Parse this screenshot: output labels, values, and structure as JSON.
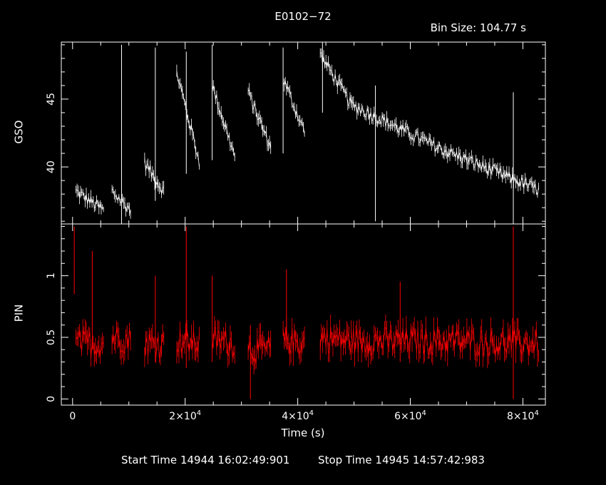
{
  "header": {
    "title": "E0102−72",
    "bin_size": "Bin Size: 104.77 s"
  },
  "footer": {
    "start_label": "Start Time",
    "start_value": "14944 16:02:49:901",
    "stop_label": "Stop Time",
    "stop_value": "14945 14:57:42:983"
  },
  "colors": {
    "gso": "#ffffff",
    "pin": "#ff0000",
    "background": "#000000",
    "axes": "#ffffff"
  },
  "chart_data": [
    {
      "type": "line",
      "panel": "top",
      "ylabel": "GSO",
      "xlim": [
        -2000,
        84000
      ],
      "ylim": [
        35.8,
        49.2
      ],
      "yticks": [
        40,
        45
      ],
      "series": [
        {
          "name": "GSO",
          "segments": [
            {
              "x": [
                600,
                5500
              ],
              "y": [
                38.2,
                36.8
              ]
            },
            {
              "x": [
                7000,
                10300
              ],
              "y": [
                38.2,
                36.8
              ]
            },
            {
              "x": [
                12800,
                16200
              ],
              "y": [
                40.3,
                38.2
              ]
            },
            {
              "x": [
                18500,
                22500
              ],
              "y": [
                47.0,
                40.4
              ]
            },
            {
              "x": [
                24800,
                28800
              ],
              "y": [
                46.0,
                40.8
              ]
            },
            {
              "x": [
                31200,
                35200
              ],
              "y": [
                45.5,
                41.4
              ]
            },
            {
              "x": [
                37400,
                41200
              ],
              "y": [
                46.5,
                42.6
              ]
            },
            {
              "x": [
                44000,
                49500
              ],
              "y": [
                48.3,
                44.6
              ]
            },
            {
              "x": [
                49500,
                65000
              ],
              "y": [
                44.6,
                41.4
              ]
            },
            {
              "x": [
                65000,
                82800
              ],
              "y": [
                41.4,
                38.3
              ]
            }
          ],
          "spikes": [
            {
              "x": 8700,
              "top": 49.0,
              "bottom": 35.8
            },
            {
              "x": 14700,
              "top": 48.8,
              "bottom": 37.5
            },
            {
              "x": 20200,
              "top": 48.5,
              "bottom": 39.5
            },
            {
              "x": 24800,
              "top": 49.0,
              "bottom": 40.5
            },
            {
              "x": 37400,
              "top": 48.8,
              "bottom": 41.0
            },
            {
              "x": 44400,
              "top": 49.2,
              "bottom": 44.0
            },
            {
              "x": 53800,
              "top": 46.0,
              "bottom": 36.0
            },
            {
              "x": 78300,
              "top": 45.5,
              "bottom": 35.8
            }
          ]
        }
      ]
    },
    {
      "type": "line",
      "panel": "bottom",
      "ylabel": "PIN",
      "xlabel": "Time (s)",
      "xlim": [
        -2000,
        84000
      ],
      "ylim": [
        -0.05,
        1.42
      ],
      "yticks": [
        0,
        0.5,
        1
      ],
      "xticks": [
        0,
        20000,
        40000,
        60000,
        80000
      ],
      "xtick_labels": [
        {
          "mant": "0",
          "exp": ""
        },
        {
          "mant": "2×10",
          "exp": "4"
        },
        {
          "mant": "4×10",
          "exp": "4"
        },
        {
          "mant": "6×10",
          "exp": "4"
        },
        {
          "mant": "8×10",
          "exp": "4"
        }
      ],
      "series": [
        {
          "name": "PIN",
          "segments": [
            {
              "x": [
                600,
                5500
              ],
              "y": [
                0.45,
                0.45
              ]
            },
            {
              "x": [
                7000,
                10300
              ],
              "y": [
                0.5,
                0.48
              ]
            },
            {
              "x": [
                12800,
                16200
              ],
              "y": [
                0.45,
                0.45
              ]
            },
            {
              "x": [
                18500,
                22500
              ],
              "y": [
                0.48,
                0.45
              ]
            },
            {
              "x": [
                24800,
                28800
              ],
              "y": [
                0.48,
                0.45
              ]
            },
            {
              "x": [
                31200,
                35200
              ],
              "y": [
                0.4,
                0.4
              ]
            },
            {
              "x": [
                37400,
                41200
              ],
              "y": [
                0.48,
                0.45
              ]
            },
            {
              "x": [
                44000,
                49500
              ],
              "y": [
                0.5,
                0.47
              ]
            },
            {
              "x": [
                49500,
                65000
              ],
              "y": [
                0.47,
                0.47
              ]
            },
            {
              "x": [
                65000,
                82800
              ],
              "y": [
                0.47,
                0.45
              ]
            }
          ],
          "spikes": [
            {
              "x": 300,
              "top": 1.4,
              "bottom": 0.85
            },
            {
              "x": 3500,
              "top": 1.2,
              "bottom": 0.4
            },
            {
              "x": 14700,
              "top": 1.0,
              "bottom": 0.3
            },
            {
              "x": 20200,
              "top": 1.4,
              "bottom": 0.25
            },
            {
              "x": 24800,
              "top": 1.0,
              "bottom": 0.3
            },
            {
              "x": 31600,
              "top": 0.6,
              "bottom": 0.0
            },
            {
              "x": 38000,
              "top": 1.05,
              "bottom": 0.4
            },
            {
              "x": 58200,
              "top": 0.95,
              "bottom": 0.3
            },
            {
              "x": 78300,
              "top": 1.4,
              "bottom": 0.0
            }
          ]
        }
      ]
    }
  ]
}
